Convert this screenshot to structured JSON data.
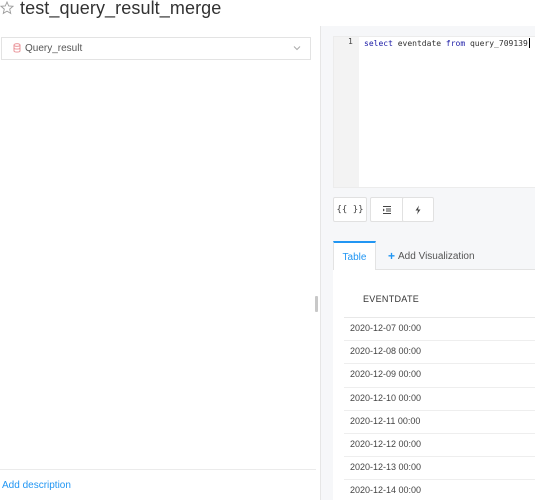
{
  "header": {
    "title": "test_query_result_merge",
    "star_icon": "star-outline-icon"
  },
  "left": {
    "datasource_label": "Query_result",
    "datasource_icon": "database-icon",
    "add_description": "Add description"
  },
  "editor": {
    "line_number": "1",
    "code": {
      "kw1": "select",
      "p1": " eventdate ",
      "kw2": "from",
      "p2": " query_709139"
    }
  },
  "toolbar": {
    "format_label": "{{ }}",
    "indent_icon": "format-indent-icon",
    "execute_icon": "lightning-icon"
  },
  "tabs": {
    "table": "Table",
    "add_visualization": "Add Visualization"
  },
  "results": {
    "column": "EVENTDATE",
    "rows": [
      "2020-12-07 00:00",
      "2020-12-08 00:00",
      "2020-12-09 00:00",
      "2020-12-10 00:00",
      "2020-12-11 00:00",
      "2020-12-12 00:00",
      "2020-12-13 00:00",
      "2020-12-14 00:00"
    ]
  },
  "colors": {
    "accent": "#2196F3",
    "keyword": "#1a1aa6"
  }
}
